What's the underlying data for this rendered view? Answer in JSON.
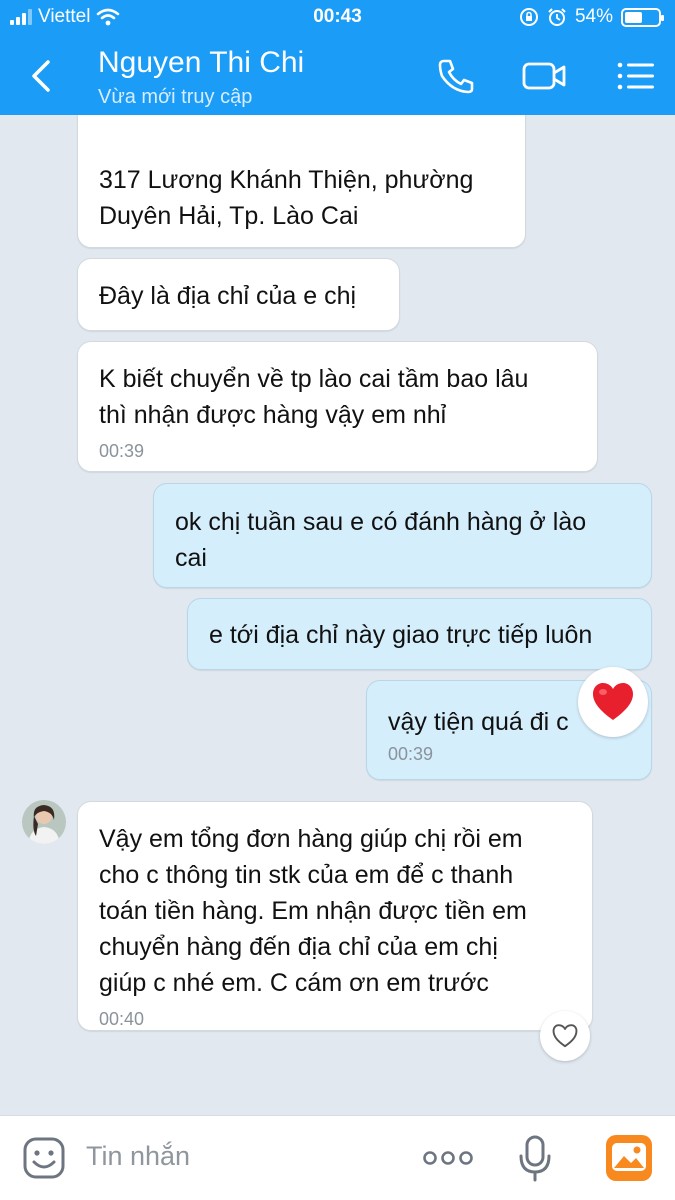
{
  "status_bar": {
    "carrier": "Viettel",
    "time": "00:43",
    "battery": "54%",
    "battery_level": 0.54
  },
  "header": {
    "contact_name": "Nguyen Thi Chi",
    "presence": "Vừa mới truy cập",
    "icons": [
      "back-icon",
      "phone-icon",
      "video-call-icon",
      "menu-icon"
    ]
  },
  "messages": [
    {
      "direction": "incoming",
      "text": "317 Lương Khánh Thiện, phường\nDuyên Hải, Tp. Lào Cai",
      "time": ""
    },
    {
      "direction": "incoming",
      "text": "Đây là địa chỉ của e chị",
      "time": ""
    },
    {
      "direction": "incoming",
      "text": "K biết chuyển về tp lào cai tầm bao lâu\nthì nhận được hàng vậy em nhỉ",
      "time": "00:39"
    },
    {
      "direction": "outgoing",
      "text": "ok chị tuần sau e có đánh hàng ở lào\ncai",
      "time": ""
    },
    {
      "direction": "outgoing",
      "text": "e tới địa chỉ này giao trực tiếp luôn",
      "time": ""
    },
    {
      "direction": "outgoing",
      "text": "vậy tiện quá đi c",
      "time": "00:39",
      "reaction": "heart"
    },
    {
      "direction": "incoming",
      "text": "Vậy em tổng đơn hàng giúp chị rồi em\ncho c thông tin stk của em để c thanh\ntoán tiền hàng. Em nhận được tiền em\nchuyển hàng đến địa chỉ của em chị\ngiúp c nhé em. C cám ơn em trước",
      "time": "00:40",
      "reaction": "heart-outline"
    }
  ],
  "input": {
    "placeholder": "Tin nhắn",
    "icons": [
      "sticker-icon",
      "more-icon",
      "microphone-icon",
      "photo-icon"
    ]
  },
  "colors": {
    "header": "#1a9cf7",
    "chat_background": "#e1e8ef",
    "incoming_bubble": "#ffffff",
    "outgoing_bubble": "#d5eefc",
    "heart": "#e8202e",
    "photo_button": "#f7891f"
  }
}
